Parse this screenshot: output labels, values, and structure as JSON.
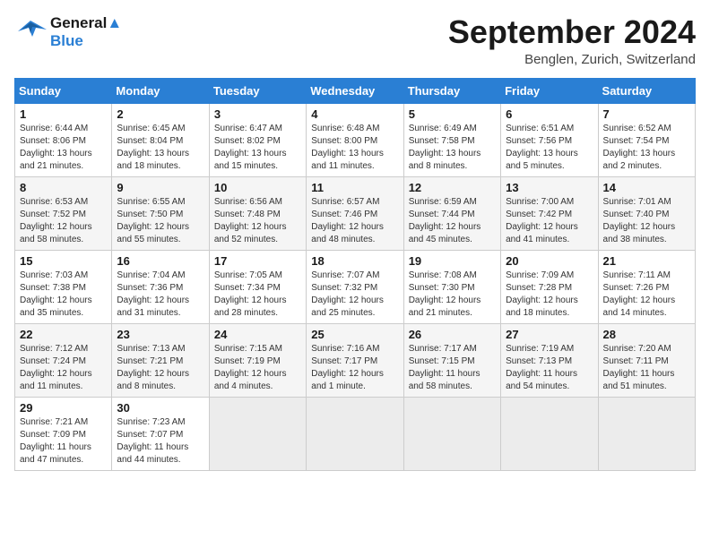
{
  "header": {
    "logo_line1": "General",
    "logo_line2": "Blue",
    "month_title": "September 2024",
    "location": "Benglen, Zurich, Switzerland"
  },
  "days_of_week": [
    "Sunday",
    "Monday",
    "Tuesday",
    "Wednesday",
    "Thursday",
    "Friday",
    "Saturday"
  ],
  "weeks": [
    [
      {
        "day": "1",
        "info": "Sunrise: 6:44 AM\nSunset: 8:06 PM\nDaylight: 13 hours\nand 21 minutes."
      },
      {
        "day": "2",
        "info": "Sunrise: 6:45 AM\nSunset: 8:04 PM\nDaylight: 13 hours\nand 18 minutes."
      },
      {
        "day": "3",
        "info": "Sunrise: 6:47 AM\nSunset: 8:02 PM\nDaylight: 13 hours\nand 15 minutes."
      },
      {
        "day": "4",
        "info": "Sunrise: 6:48 AM\nSunset: 8:00 PM\nDaylight: 13 hours\nand 11 minutes."
      },
      {
        "day": "5",
        "info": "Sunrise: 6:49 AM\nSunset: 7:58 PM\nDaylight: 13 hours\nand 8 minutes."
      },
      {
        "day": "6",
        "info": "Sunrise: 6:51 AM\nSunset: 7:56 PM\nDaylight: 13 hours\nand 5 minutes."
      },
      {
        "day": "7",
        "info": "Sunrise: 6:52 AM\nSunset: 7:54 PM\nDaylight: 13 hours\nand 2 minutes."
      }
    ],
    [
      {
        "day": "8",
        "info": "Sunrise: 6:53 AM\nSunset: 7:52 PM\nDaylight: 12 hours\nand 58 minutes."
      },
      {
        "day": "9",
        "info": "Sunrise: 6:55 AM\nSunset: 7:50 PM\nDaylight: 12 hours\nand 55 minutes."
      },
      {
        "day": "10",
        "info": "Sunrise: 6:56 AM\nSunset: 7:48 PM\nDaylight: 12 hours\nand 52 minutes."
      },
      {
        "day": "11",
        "info": "Sunrise: 6:57 AM\nSunset: 7:46 PM\nDaylight: 12 hours\nand 48 minutes."
      },
      {
        "day": "12",
        "info": "Sunrise: 6:59 AM\nSunset: 7:44 PM\nDaylight: 12 hours\nand 45 minutes."
      },
      {
        "day": "13",
        "info": "Sunrise: 7:00 AM\nSunset: 7:42 PM\nDaylight: 12 hours\nand 41 minutes."
      },
      {
        "day": "14",
        "info": "Sunrise: 7:01 AM\nSunset: 7:40 PM\nDaylight: 12 hours\nand 38 minutes."
      }
    ],
    [
      {
        "day": "15",
        "info": "Sunrise: 7:03 AM\nSunset: 7:38 PM\nDaylight: 12 hours\nand 35 minutes."
      },
      {
        "day": "16",
        "info": "Sunrise: 7:04 AM\nSunset: 7:36 PM\nDaylight: 12 hours\nand 31 minutes."
      },
      {
        "day": "17",
        "info": "Sunrise: 7:05 AM\nSunset: 7:34 PM\nDaylight: 12 hours\nand 28 minutes."
      },
      {
        "day": "18",
        "info": "Sunrise: 7:07 AM\nSunset: 7:32 PM\nDaylight: 12 hours\nand 25 minutes."
      },
      {
        "day": "19",
        "info": "Sunrise: 7:08 AM\nSunset: 7:30 PM\nDaylight: 12 hours\nand 21 minutes."
      },
      {
        "day": "20",
        "info": "Sunrise: 7:09 AM\nSunset: 7:28 PM\nDaylight: 12 hours\nand 18 minutes."
      },
      {
        "day": "21",
        "info": "Sunrise: 7:11 AM\nSunset: 7:26 PM\nDaylight: 12 hours\nand 14 minutes."
      }
    ],
    [
      {
        "day": "22",
        "info": "Sunrise: 7:12 AM\nSunset: 7:24 PM\nDaylight: 12 hours\nand 11 minutes."
      },
      {
        "day": "23",
        "info": "Sunrise: 7:13 AM\nSunset: 7:21 PM\nDaylight: 12 hours\nand 8 minutes."
      },
      {
        "day": "24",
        "info": "Sunrise: 7:15 AM\nSunset: 7:19 PM\nDaylight: 12 hours\nand 4 minutes."
      },
      {
        "day": "25",
        "info": "Sunrise: 7:16 AM\nSunset: 7:17 PM\nDaylight: 12 hours\nand 1 minute."
      },
      {
        "day": "26",
        "info": "Sunrise: 7:17 AM\nSunset: 7:15 PM\nDaylight: 11 hours\nand 58 minutes."
      },
      {
        "day": "27",
        "info": "Sunrise: 7:19 AM\nSunset: 7:13 PM\nDaylight: 11 hours\nand 54 minutes."
      },
      {
        "day": "28",
        "info": "Sunrise: 7:20 AM\nSunset: 7:11 PM\nDaylight: 11 hours\nand 51 minutes."
      }
    ],
    [
      {
        "day": "29",
        "info": "Sunrise: 7:21 AM\nSunset: 7:09 PM\nDaylight: 11 hours\nand 47 minutes."
      },
      {
        "day": "30",
        "info": "Sunrise: 7:23 AM\nSunset: 7:07 PM\nDaylight: 11 hours\nand 44 minutes."
      },
      {
        "day": "",
        "info": ""
      },
      {
        "day": "",
        "info": ""
      },
      {
        "day": "",
        "info": ""
      },
      {
        "day": "",
        "info": ""
      },
      {
        "day": "",
        "info": ""
      }
    ]
  ]
}
